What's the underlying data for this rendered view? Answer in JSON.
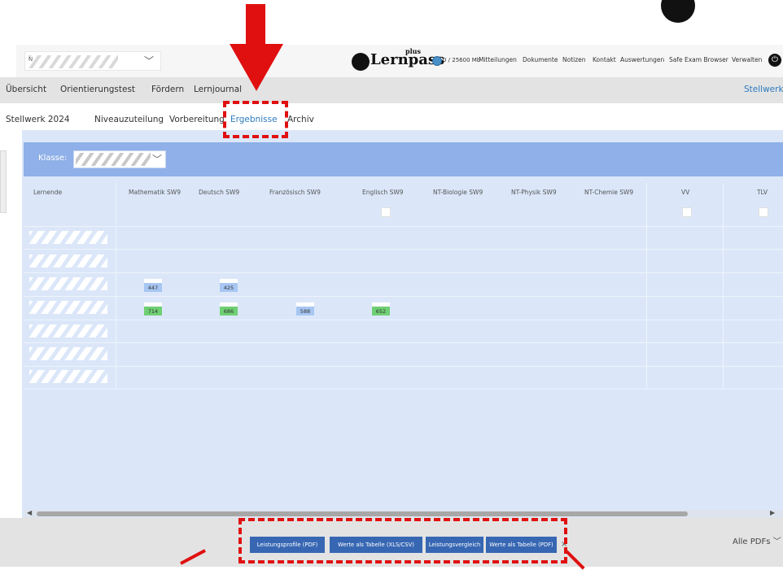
{
  "header": {
    "school_select_value": "N",
    "logo_text": "Lernpass",
    "logo_plus": "plus",
    "storage": "0 / 25600 Mb",
    "topnav": [
      "Mitteilungen",
      "Dokumente",
      "Notizen",
      "Kontakt",
      "Auswertungen",
      "Safe Exam Browser",
      "Verwalten"
    ]
  },
  "mainnav": {
    "items": [
      "Übersicht",
      "Orientierungstest",
      "Fördern",
      "Lernjournal"
    ],
    "right": "Stellwerk"
  },
  "subnav": {
    "items": [
      "Stellwerk 2024",
      "Niveauzuteilung",
      "Vorbereitung",
      "Ergebnisse",
      "Archiv"
    ],
    "active": "Ergebnisse"
  },
  "filter": {
    "class_label": "Klasse:"
  },
  "table": {
    "columns": [
      "Lernende",
      "Mathematik SW9",
      "Deutsch SW9",
      "Französisch SW9",
      "Englisch SW9",
      "NT-Biologie SW9",
      "NT-Physik SW9",
      "NT-Chemie SW9",
      "VV",
      "TLV"
    ],
    "rows": [
      {
        "scores": []
      },
      {
        "scores": []
      },
      {
        "scores": [
          {
            "col": "Mathematik SW9",
            "value": "447",
            "color": "blue"
          },
          {
            "col": "Deutsch SW9",
            "value": "425",
            "color": "blue"
          }
        ]
      },
      {
        "scores": [
          {
            "col": "Mathematik SW9",
            "value": "714",
            "color": "green"
          },
          {
            "col": "Deutsch SW9",
            "value": "686",
            "color": "green"
          },
          {
            "col": "Französisch SW9",
            "value": "588",
            "color": "blue"
          },
          {
            "col": "Englisch SW9",
            "value": "652",
            "color": "green"
          }
        ]
      },
      {
        "scores": []
      },
      {
        "scores": []
      },
      {
        "scores": []
      }
    ]
  },
  "footer": {
    "buttons": [
      "Leistungsprofile (PDF)",
      "Werte als Tabelle (XLS/CSV)",
      "Leistungsvergleich",
      "Werte als Tabelle (PDF)"
    ],
    "close": "×",
    "all_pdfs": "Alle PDFs ﹀"
  },
  "colors": {
    "annotation": "#e01010",
    "accent": "#2c7abf",
    "class_bar": "#8fb0e8",
    "content_bg": "#dbe7f9",
    "button": "#3767b3"
  }
}
